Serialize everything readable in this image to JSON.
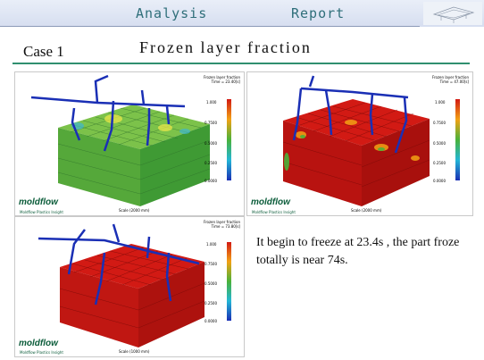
{
  "header": {
    "tab_analysis": "Analysis",
    "tab_report": "Report"
  },
  "case_label": "Case 1",
  "title": "Frozen layer fraction",
  "caption": "It begin to freeze at 23.4s , the part froze totally is near 74s.",
  "panels": [
    {
      "result_line1": "Frozen layer fraction",
      "result_line2": "Time = 23.40[s]",
      "scale_values": [
        "1.000",
        "0.7500",
        "0.5000",
        "0.2500",
        "0.0000"
      ],
      "scale_text": "Scale (2000 mm)",
      "logo": "moldflow",
      "logo_sub": "Moldflow Plastics Insight"
    },
    {
      "result_line1": "Frozen layer fraction",
      "result_line2": "Time = 47.00[s]",
      "scale_values": [
        "1.000",
        "0.7500",
        "0.5000",
        "0.2500",
        "0.0000"
      ],
      "scale_text": "Scale (2000 mm)",
      "logo": "moldflow",
      "logo_sub": "Moldflow Plastics Insight"
    },
    {
      "result_line1": "Frozen layer fraction",
      "result_line2": "Time = 73.80[s]",
      "scale_values": [
        "1.000",
        "0.7500",
        "0.5000",
        "0.2500",
        "0.0000"
      ],
      "scale_text": "Scale (1000 mm)",
      "logo": "moldflow",
      "logo_sub": "Moldflow Plastics Insight"
    }
  ],
  "colors": {
    "accent_rule": "#2f8f6f",
    "header_text": "#2f6f7a",
    "frozen": "#d21a14",
    "melt": "#3aa23a",
    "runner": "#1a2fb5"
  }
}
